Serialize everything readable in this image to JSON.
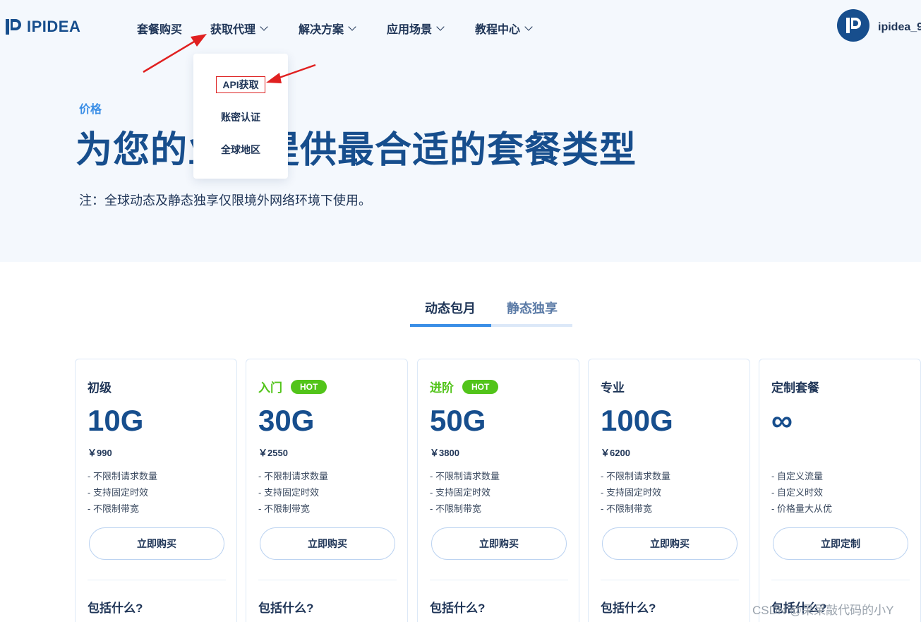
{
  "header": {
    "logo_text": "IPIDEA",
    "nav": [
      {
        "label": "套餐购买"
      },
      {
        "label": "获取代理"
      },
      {
        "label": "解决方案"
      },
      {
        "label": "应用场景"
      },
      {
        "label": "教程中心"
      }
    ],
    "username": "ipidea_9"
  },
  "dropdown": {
    "items": [
      {
        "label": "API获取",
        "highlighted": true
      },
      {
        "label": "账密认证"
      },
      {
        "label": "全球地区"
      }
    ]
  },
  "hero": {
    "eyebrow": "价格",
    "title": "为您的业务提供最合适的套餐类型",
    "note": "注：全球动态及静态独享仅限境外网络环境下使用。"
  },
  "tabs": [
    {
      "label": "动态包月",
      "active": true
    },
    {
      "label": "静态独享",
      "active": false
    }
  ],
  "plans": [
    {
      "tier": "初级",
      "hot": "",
      "size": "10G",
      "price": "￥990",
      "features": [
        "- 不限制请求数量",
        "- 支持固定时效",
        "- 不限制带宽"
      ],
      "button": "立即购买",
      "includes": "包括什么?"
    },
    {
      "tier": "入门",
      "hot": "HOT",
      "size": "30G",
      "price": "￥2550",
      "features": [
        "- 不限制请求数量",
        "- 支持固定时效",
        "- 不限制带宽"
      ],
      "button": "立即购买",
      "includes": "包括什么?"
    },
    {
      "tier": "进阶",
      "hot": "HOT",
      "size": "50G",
      "price": "￥3800",
      "features": [
        "- 不限制请求数量",
        "- 支持固定时效",
        "- 不限制带宽"
      ],
      "button": "立即购买",
      "includes": "包括什么?"
    },
    {
      "tier": "专业",
      "hot": "",
      "size": "100G",
      "price": "￥6200",
      "features": [
        "- 不限制请求数量",
        "- 支持固定时效",
        "- 不限制带宽"
      ],
      "button": "立即购买",
      "includes": "包括什么?"
    },
    {
      "tier": "定制套餐",
      "hot": "",
      "size": "∞",
      "price": "",
      "features": [
        "- 自定义流量",
        "- 自定义时效",
        "- 价格量大从优"
      ],
      "button": "立即定制",
      "includes": "包括什么?"
    }
  ],
  "watermark": "CSDN @呆呆敲代码的小Y",
  "colors": {
    "brand": "#174e8d",
    "accent": "#3a8ee6",
    "hot": "#52c41a",
    "annotation": "#e02020"
  }
}
